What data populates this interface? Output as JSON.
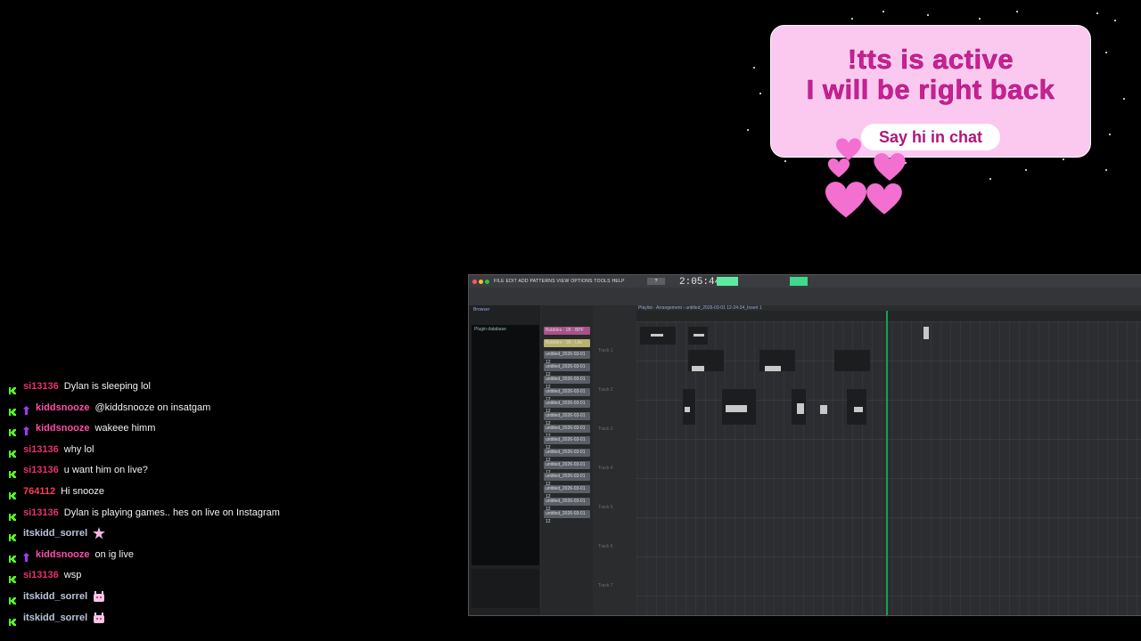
{
  "banner": {
    "line1": "!tts is active",
    "line2": "I will be right back",
    "pill": "Say hi in chat"
  },
  "colors": {
    "banner_bg": "#fbc8ef",
    "banner_text": "#cc1f96",
    "heart": "#f36fd0",
    "kick_green": "#53fc18",
    "playhead": "#13a34f"
  },
  "chat": [
    {
      "user": "si13136",
      "user_color": "#e8326f",
      "badge": null,
      "message": "Dylan is sleeping lol",
      "emote": null
    },
    {
      "user": "kiddsnooze",
      "user_color": "#ff4fa8",
      "badge": "purple",
      "message": "@kiddsnooze on insatgam",
      "emote": null
    },
    {
      "user": "kiddsnooze",
      "user_color": "#ff4fa8",
      "badge": "purple",
      "message": "wakeee himm",
      "emote": null
    },
    {
      "user": "si13136",
      "user_color": "#e8326f",
      "badge": null,
      "message": "why lol",
      "emote": null
    },
    {
      "user": "si13136",
      "user_color": "#e8326f",
      "badge": null,
      "message": "u want him on live?",
      "emote": null
    },
    {
      "user": "764112",
      "user_color": "#ff3a5c",
      "badge": null,
      "message": "Hi snooze",
      "emote": null
    },
    {
      "user": "si13136",
      "user_color": "#e8326f",
      "badge": null,
      "message": "Dylan is playing games.. hes on live on Instagram",
      "emote": null
    },
    {
      "user": "itskidd_sorrel",
      "user_color": "#b8c6dc",
      "badge": null,
      "message": "",
      "emote": "star-emote"
    },
    {
      "user": "kiddsnooze",
      "user_color": "#ff4fa8",
      "badge": "purple",
      "message": "on ig live",
      "emote": null
    },
    {
      "user": "si13136",
      "user_color": "#e8326f",
      "badge": null,
      "message": "wsp",
      "emote": null
    },
    {
      "user": "itskidd_sorrel",
      "user_color": "#b8c6dc",
      "badge": null,
      "message": "",
      "emote": "hands-emote"
    },
    {
      "user": "itskidd_sorrel",
      "user_color": "#b8c6dc",
      "badge": null,
      "message": "",
      "emote": "hands-emote"
    }
  ],
  "daw": {
    "menu": "FILE  EDIT  ADD  PATTERNS  VIEW  OPTIONS  TOOLS  HELP",
    "time": "2:05:44",
    "tempo": "?",
    "browser_title": "Browser",
    "browser_item": "Plugin database",
    "playlist_title": "Playlist - Arrangement › untitled_2026-03-01 12-24-34_Insert 1",
    "clips": [
      "Bubbles - 1B - BPF",
      "Bubbles - 1B - Lite",
      "untitled_2026-03-01 12",
      "untitled_2026-03-01 12",
      "untitled_2026-03-01 12",
      "untitled_2026-03-01 12",
      "untitled_2026-03-01 12",
      "untitled_2026-03-01 12",
      "untitled_2026-03-01 12",
      "untitled_2026-03-01 12",
      "untitled_2026-03-01 12",
      "untitled_2026-03-01 12",
      "untitled_2026-03-01 12",
      "untitled_2026-03-01 12",
      "untitled_2026-03-01 12",
      "untitled_2026-03-01 12"
    ],
    "tracks": [
      "Track 1",
      "Track 2",
      "Track 3",
      "Track 4",
      "Track 5",
      "Track 6",
      "Track 7",
      "Track 8"
    ]
  }
}
